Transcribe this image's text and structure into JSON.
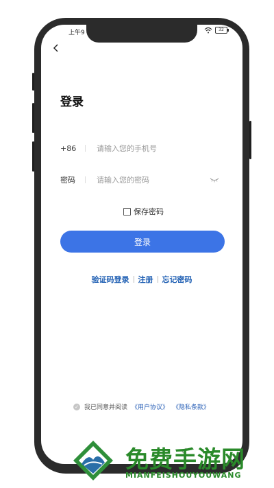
{
  "status": {
    "time": "上午9",
    "battery": "32"
  },
  "header": {
    "title": "登录"
  },
  "phone_field": {
    "label": "+86",
    "placeholder": "请输入您的手机号"
  },
  "password_field": {
    "label": "密码",
    "placeholder": "请输入您的密码"
  },
  "remember": {
    "label": "保存密码",
    "checked": false
  },
  "login_button": {
    "label": "登录"
  },
  "links": {
    "sms_login": "验证码登录",
    "register": "注册",
    "forgot": "忘记密码"
  },
  "agreement": {
    "prefix": "我已同意并阅读",
    "user_agreement": "《用户协议》",
    "privacy": "《隐私条款》"
  },
  "watermark": {
    "title": "免费手游网",
    "subtitle": "MIANFEISHOUYOUWANG"
  },
  "colors": {
    "accent": "#3c74e6",
    "link": "#1f5fb3",
    "watermark": "#2a8a2a"
  }
}
